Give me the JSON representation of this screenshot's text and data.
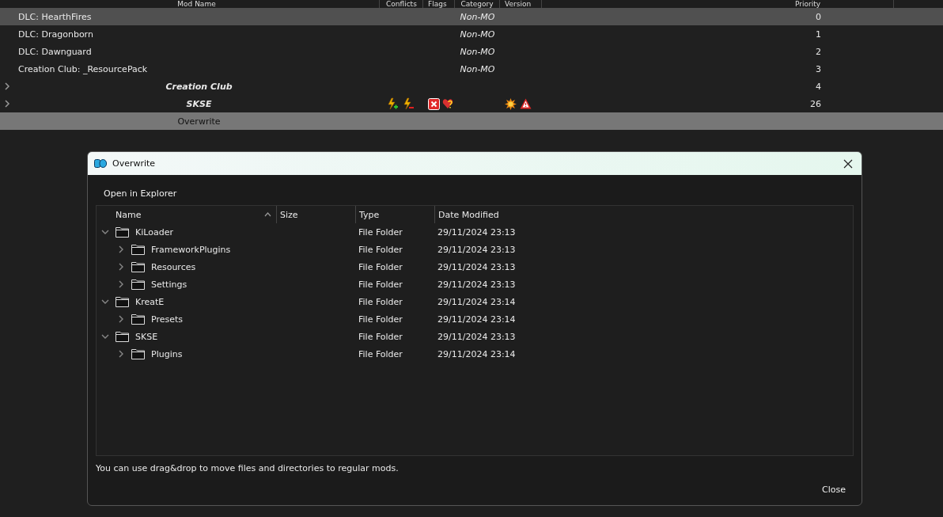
{
  "mod_list": {
    "columns": [
      {
        "label": "Mod Name",
        "kind": "name"
      },
      {
        "label": "Conflicts",
        "kind": "conflicts"
      },
      {
        "label": "Flags",
        "kind": "flags"
      },
      {
        "label": "Category",
        "kind": "category"
      },
      {
        "label": "Version",
        "kind": "version"
      },
      {
        "label": "Priority",
        "kind": "priority"
      }
    ],
    "rows": [
      {
        "kind": "mod",
        "name": "DLC: HearthFires",
        "category": "Non-MO",
        "priority": "0",
        "selected": true
      },
      {
        "kind": "mod",
        "name": "DLC: Dragonborn",
        "category": "Non-MO",
        "priority": "1",
        "selected": false
      },
      {
        "kind": "mod",
        "name": "DLC: Dawnguard",
        "category": "Non-MO",
        "priority": "2",
        "selected": false
      },
      {
        "kind": "mod",
        "name": "Creation Club: _ResourcePack",
        "category": "Non-MO",
        "priority": "3",
        "selected": false
      },
      {
        "kind": "separator",
        "name": "Creation Club",
        "priority": "4",
        "expanded": false,
        "selected": false
      },
      {
        "kind": "separator",
        "name": "SKSE",
        "priority": "26",
        "expanded": false,
        "selected": false,
        "conflicts": [
          {
            "kind": "plus"
          },
          {
            "kind": "minus"
          }
        ],
        "flags": [
          {
            "kind": "error"
          },
          {
            "kind": "heart"
          }
        ],
        "version_icons": [
          {
            "kind": "burst"
          },
          {
            "kind": "warning"
          }
        ]
      },
      {
        "kind": "overwrite",
        "name": "Overwrite",
        "selected": false
      }
    ]
  },
  "dialog": {
    "title": "Overwrite",
    "toolbar_button": "Open in Explorer",
    "columns": [
      {
        "label": "Name",
        "sorted": true
      },
      {
        "label": "Size",
        "sorted": false
      },
      {
        "label": "Type",
        "sorted": false
      },
      {
        "label": "Date Modified",
        "sorted": false
      }
    ],
    "tree": [
      {
        "name": "KiLoader",
        "type": "File Folder",
        "date": "29/11/2024 23:13",
        "expanded": true,
        "children": [
          {
            "name": "FrameworkPlugins",
            "type": "File Folder",
            "date": "29/11/2024 23:13",
            "expanded": false
          },
          {
            "name": "Resources",
            "type": "File Folder",
            "date": "29/11/2024 23:13",
            "expanded": false
          },
          {
            "name": "Settings",
            "type": "File Folder",
            "date": "29/11/2024 23:13",
            "expanded": false
          }
        ]
      },
      {
        "name": "KreatE",
        "type": "File Folder",
        "date": "29/11/2024 23:14",
        "expanded": true,
        "children": [
          {
            "name": "Presets",
            "type": "File Folder",
            "date": "29/11/2024 23:14",
            "expanded": false
          }
        ]
      },
      {
        "name": "SKSE",
        "type": "File Folder",
        "date": "29/11/2024 23:13",
        "expanded": true,
        "children": [
          {
            "name": "Plugins",
            "type": "File Folder",
            "date": "29/11/2024 23:14",
            "expanded": false
          }
        ]
      }
    ],
    "hint": "You can use drag&drop to move files and directories to regular mods.",
    "close_button": "Close"
  }
}
